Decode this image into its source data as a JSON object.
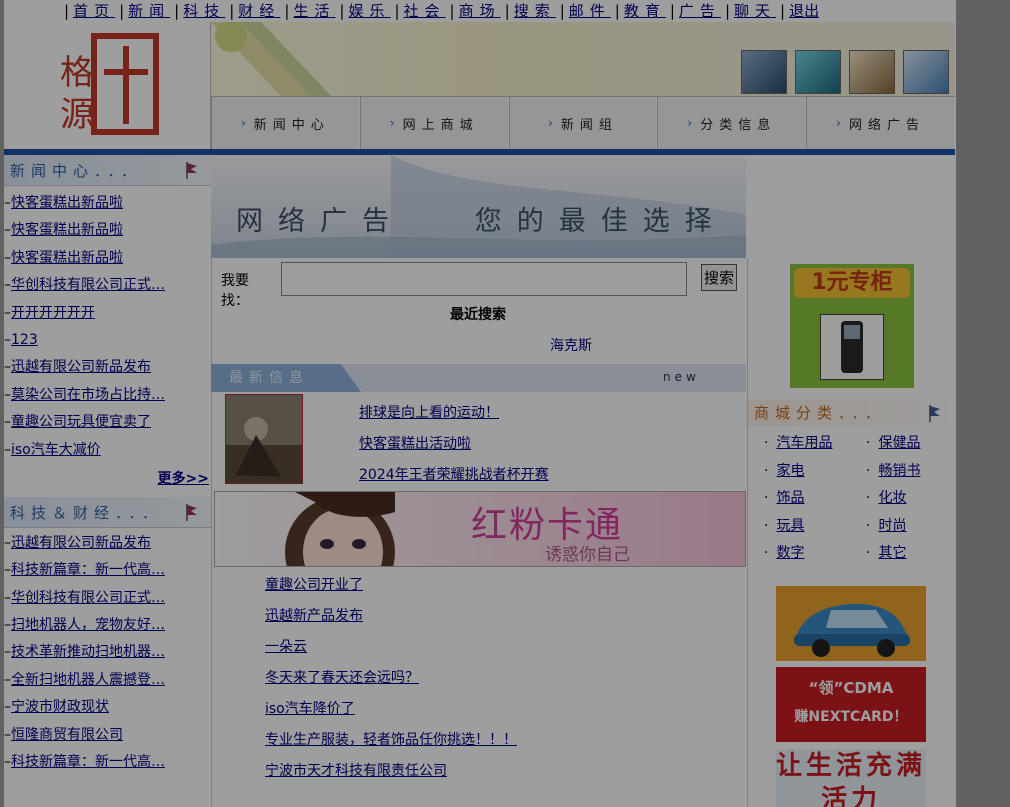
{
  "top_nav": [
    "首页",
    "新闻",
    "科技",
    "财经",
    "生活",
    "娱乐",
    "社会",
    "商场",
    "搜索",
    "邮件",
    "教育",
    "广告",
    "聊天",
    "退出"
  ],
  "logo_text": [
    "千",
    "格",
    "源"
  ],
  "main_nav": [
    "新闻中心",
    "网上商城",
    "新闻组",
    "分类信息",
    "网络广告"
  ],
  "news_center": {
    "title": "新闻中心．．．",
    "items": [
      "快客蛋糕出新品啦",
      "快客蛋糕出新品啦",
      "快客蛋糕出新品啦",
      "华创科技有限公司正式…",
      "开开开开开开",
      "123",
      "迅越有限公司新品发布",
      "莫染公司在市场占比持…",
      "童趣公司玩具便宜卖了",
      "iso汽车大减价"
    ],
    "more": "更多>>"
  },
  "tech_finance": {
    "title": "科技＆财经．．．",
    "items": [
      "迅越有限公司新品发布",
      "科技新篇章：新一代高…",
      "华创科技有限公司正式…",
      "扫地机器人，宠物友好…",
      "技术革新推动扫地机器…",
      "全新扫地机器人震撼登…",
      "宁波市财政现状",
      "恒隆商贸有限公司",
      "科技新篇章：新一代高…"
    ]
  },
  "ad_banner": {
    "text": "网络广告",
    "tagline": "您的最佳选择"
  },
  "search": {
    "label": "我要找：",
    "value": "",
    "button": "搜索"
  },
  "recent": {
    "title": "最近搜索",
    "item": "海克斯"
  },
  "latest_info": {
    "title": "最新信息",
    "badge": "new",
    "items": [
      "排球是向上看的运动！",
      "快客蛋糕出活动啦",
      "2024年王者荣耀挑战者杯开赛"
    ]
  },
  "pink_ad": {
    "title": "红粉卡通",
    "subtitle": "诱惑你自己"
  },
  "center_links": [
    "童趣公司开业了",
    "迅越新产品发布",
    "一朵云",
    "冬天来了春天还会远吗？",
    "iso汽车降价了",
    "专业生产服装，轻者饰品任你挑选！！！",
    "宁波市天才科技有限责任公司"
  ],
  "yuan_ad": "1元专柜",
  "shop_categories": {
    "title": "商城分类．．．",
    "items": [
      "汽车用品",
      "保健品",
      "家电",
      "畅销书",
      "饰品",
      "化妆",
      "玩具",
      "时尚",
      "数字",
      "其它"
    ]
  },
  "side_ads": {
    "cdma_line1": "“领”CDMA",
    "cdma_line2": "赚NEXTCARD！",
    "life": "让生活充满活力"
  }
}
